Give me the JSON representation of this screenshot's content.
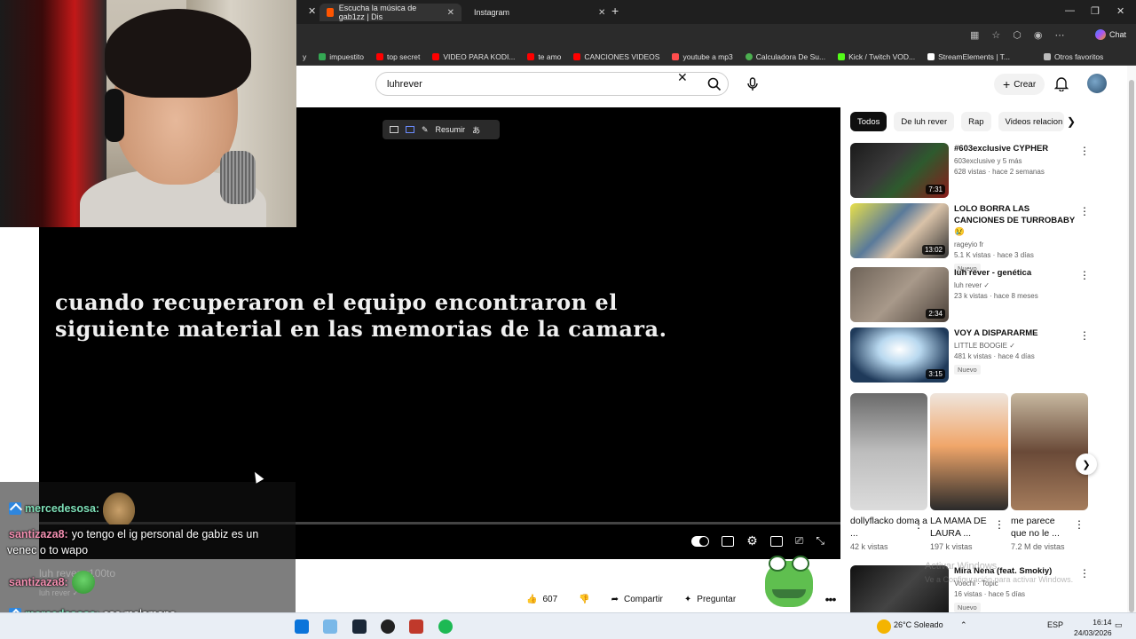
{
  "browser": {
    "tabs": [
      {
        "label": "Escucha la música de gab1zz | Dis",
        "active": true,
        "color": "#ff5500"
      },
      {
        "label": "Instagram",
        "active": false,
        "color": "#e1306c"
      }
    ],
    "new_tab": "+",
    "bookmarks": [
      {
        "label": "y",
        "color": "#888888"
      },
      {
        "label": "impuestito",
        "color": "#34a853"
      },
      {
        "label": "top secret",
        "color": "#ff0000"
      },
      {
        "label": "VIDEO PARA KODI...",
        "color": "#ff0000"
      },
      {
        "label": "te amo",
        "color": "#ff0000"
      },
      {
        "label": "CANCIONES VIDEOS",
        "color": "#ff0000"
      },
      {
        "label": "youtube a mp3",
        "color": "#ff4d4d"
      },
      {
        "label": "Calculadora De Su...",
        "color": "#4caf50"
      },
      {
        "label": "Kick / Twitch VOD...",
        "color": "#53fc18"
      },
      {
        "label": "StreamElements | T...",
        "color": "#ffffff"
      }
    ],
    "other_favorites": "Otros favoritos",
    "chat_label": "Chat"
  },
  "youtube": {
    "search_value": "luhrever",
    "create_label": "Crear",
    "pip_label": "Resumir",
    "caption": "cuando recuperaron el equipo encontraron el siguiente material en las memorias de la camara.",
    "actions": {
      "likes": "607",
      "share": "Compartir",
      "ask": "Preguntar"
    },
    "chips": [
      "Todos",
      "De luh rever",
      "Rap",
      "Videos relacion"
    ],
    "recommendations": [
      {
        "title": "#603exclusive CYPHER",
        "channel": "603exclusive y 5 más",
        "meta": "628 vistas · hace 2 semanas",
        "duration": "7:31",
        "badge": ""
      },
      {
        "title": "LOLO BORRA LAS CANCIONES DE TURROBABY 😢",
        "channel": "rageyio fr",
        "meta": "5.1 K vistas · hace 3 días",
        "duration": "13:02",
        "badge": "Nuevo"
      },
      {
        "title": "luh rever - genética",
        "channel": "luh rever ✓",
        "meta": "23 k vistas · hace 8 meses",
        "duration": "2:34",
        "badge": ""
      },
      {
        "title": "VOY A DISPARARME",
        "channel": "LITTLE BOOGIE ✓",
        "meta": "481 k vistas · hace 4 días",
        "duration": "3:15",
        "badge": "Nuevo"
      }
    ],
    "shorts": [
      {
        "title": "dollyflacko doma a ...",
        "views": "42 k vistas"
      },
      {
        "title": "LA MAMA DE LAURA ...",
        "views": "197 k vistas"
      },
      {
        "title": "me parece que no le ...",
        "views": "7.2 M de vistas"
      }
    ],
    "bottom_rec": {
      "title": "Mira Nena (feat. Smokiy)",
      "channel": "Voochi · Topic",
      "meta": "16 vistas · hace 5 días",
      "badge": "Nuevo"
    },
    "watermark": "Activar Windows",
    "watermark_sub": "Ve a Configuración para activar Windows."
  },
  "overlay_chat": {
    "lines": [
      {
        "user": "mercedesosa:",
        "msg": "",
        "user_color": "mint"
      },
      {
        "user": "santizaza8:",
        "msg": "yo tengo el ig personal de gabiz es un",
        "user_color": "pink"
      },
      {
        "user": "",
        "msg": "venec o to wapo",
        "user_color": ""
      },
      {
        "user": "santizaza8:",
        "msg": "",
        "user_color": "pink"
      },
      {
        "user": "mercedesosa:",
        "msg": "ese molamano",
        "user_color": "mint"
      }
    ],
    "ghost_1": "luh rever x100to",
    "ghost_2": "luh rever ✓"
  },
  "taskbar": {
    "weather": "26°C  Soleado",
    "lang": "ESP",
    "time": "16:14",
    "date": "24/03/2026"
  }
}
